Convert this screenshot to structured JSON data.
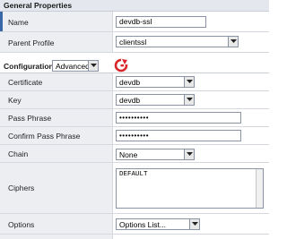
{
  "general_properties": {
    "header": "General Properties",
    "name_label": "Name",
    "name_value": "devdb-ssl",
    "parent_profile_label": "Parent Profile",
    "parent_profile_value": "clientssl"
  },
  "configuration": {
    "label": "Configuration:",
    "mode_value": "Advanced",
    "reload_icon": "reload-icon"
  },
  "fields": {
    "certificate_label": "Certificate",
    "certificate_value": "devdb",
    "key_label": "Key",
    "key_value": "devdb",
    "pass_phrase_label": "Pass Phrase",
    "pass_phrase_value": "••••••••••",
    "confirm_pass_phrase_label": "Confirm Pass Phrase",
    "confirm_pass_phrase_value": "••••••••••",
    "chain_label": "Chain",
    "chain_value": "None",
    "ciphers_label": "Ciphers",
    "ciphers_value": "DEFAULT",
    "options_label": "Options",
    "options_value": "Options List..."
  },
  "colors": {
    "accent": "#3a67a8",
    "label_bg": "#eceef2",
    "reload_red": "#d9262a"
  }
}
